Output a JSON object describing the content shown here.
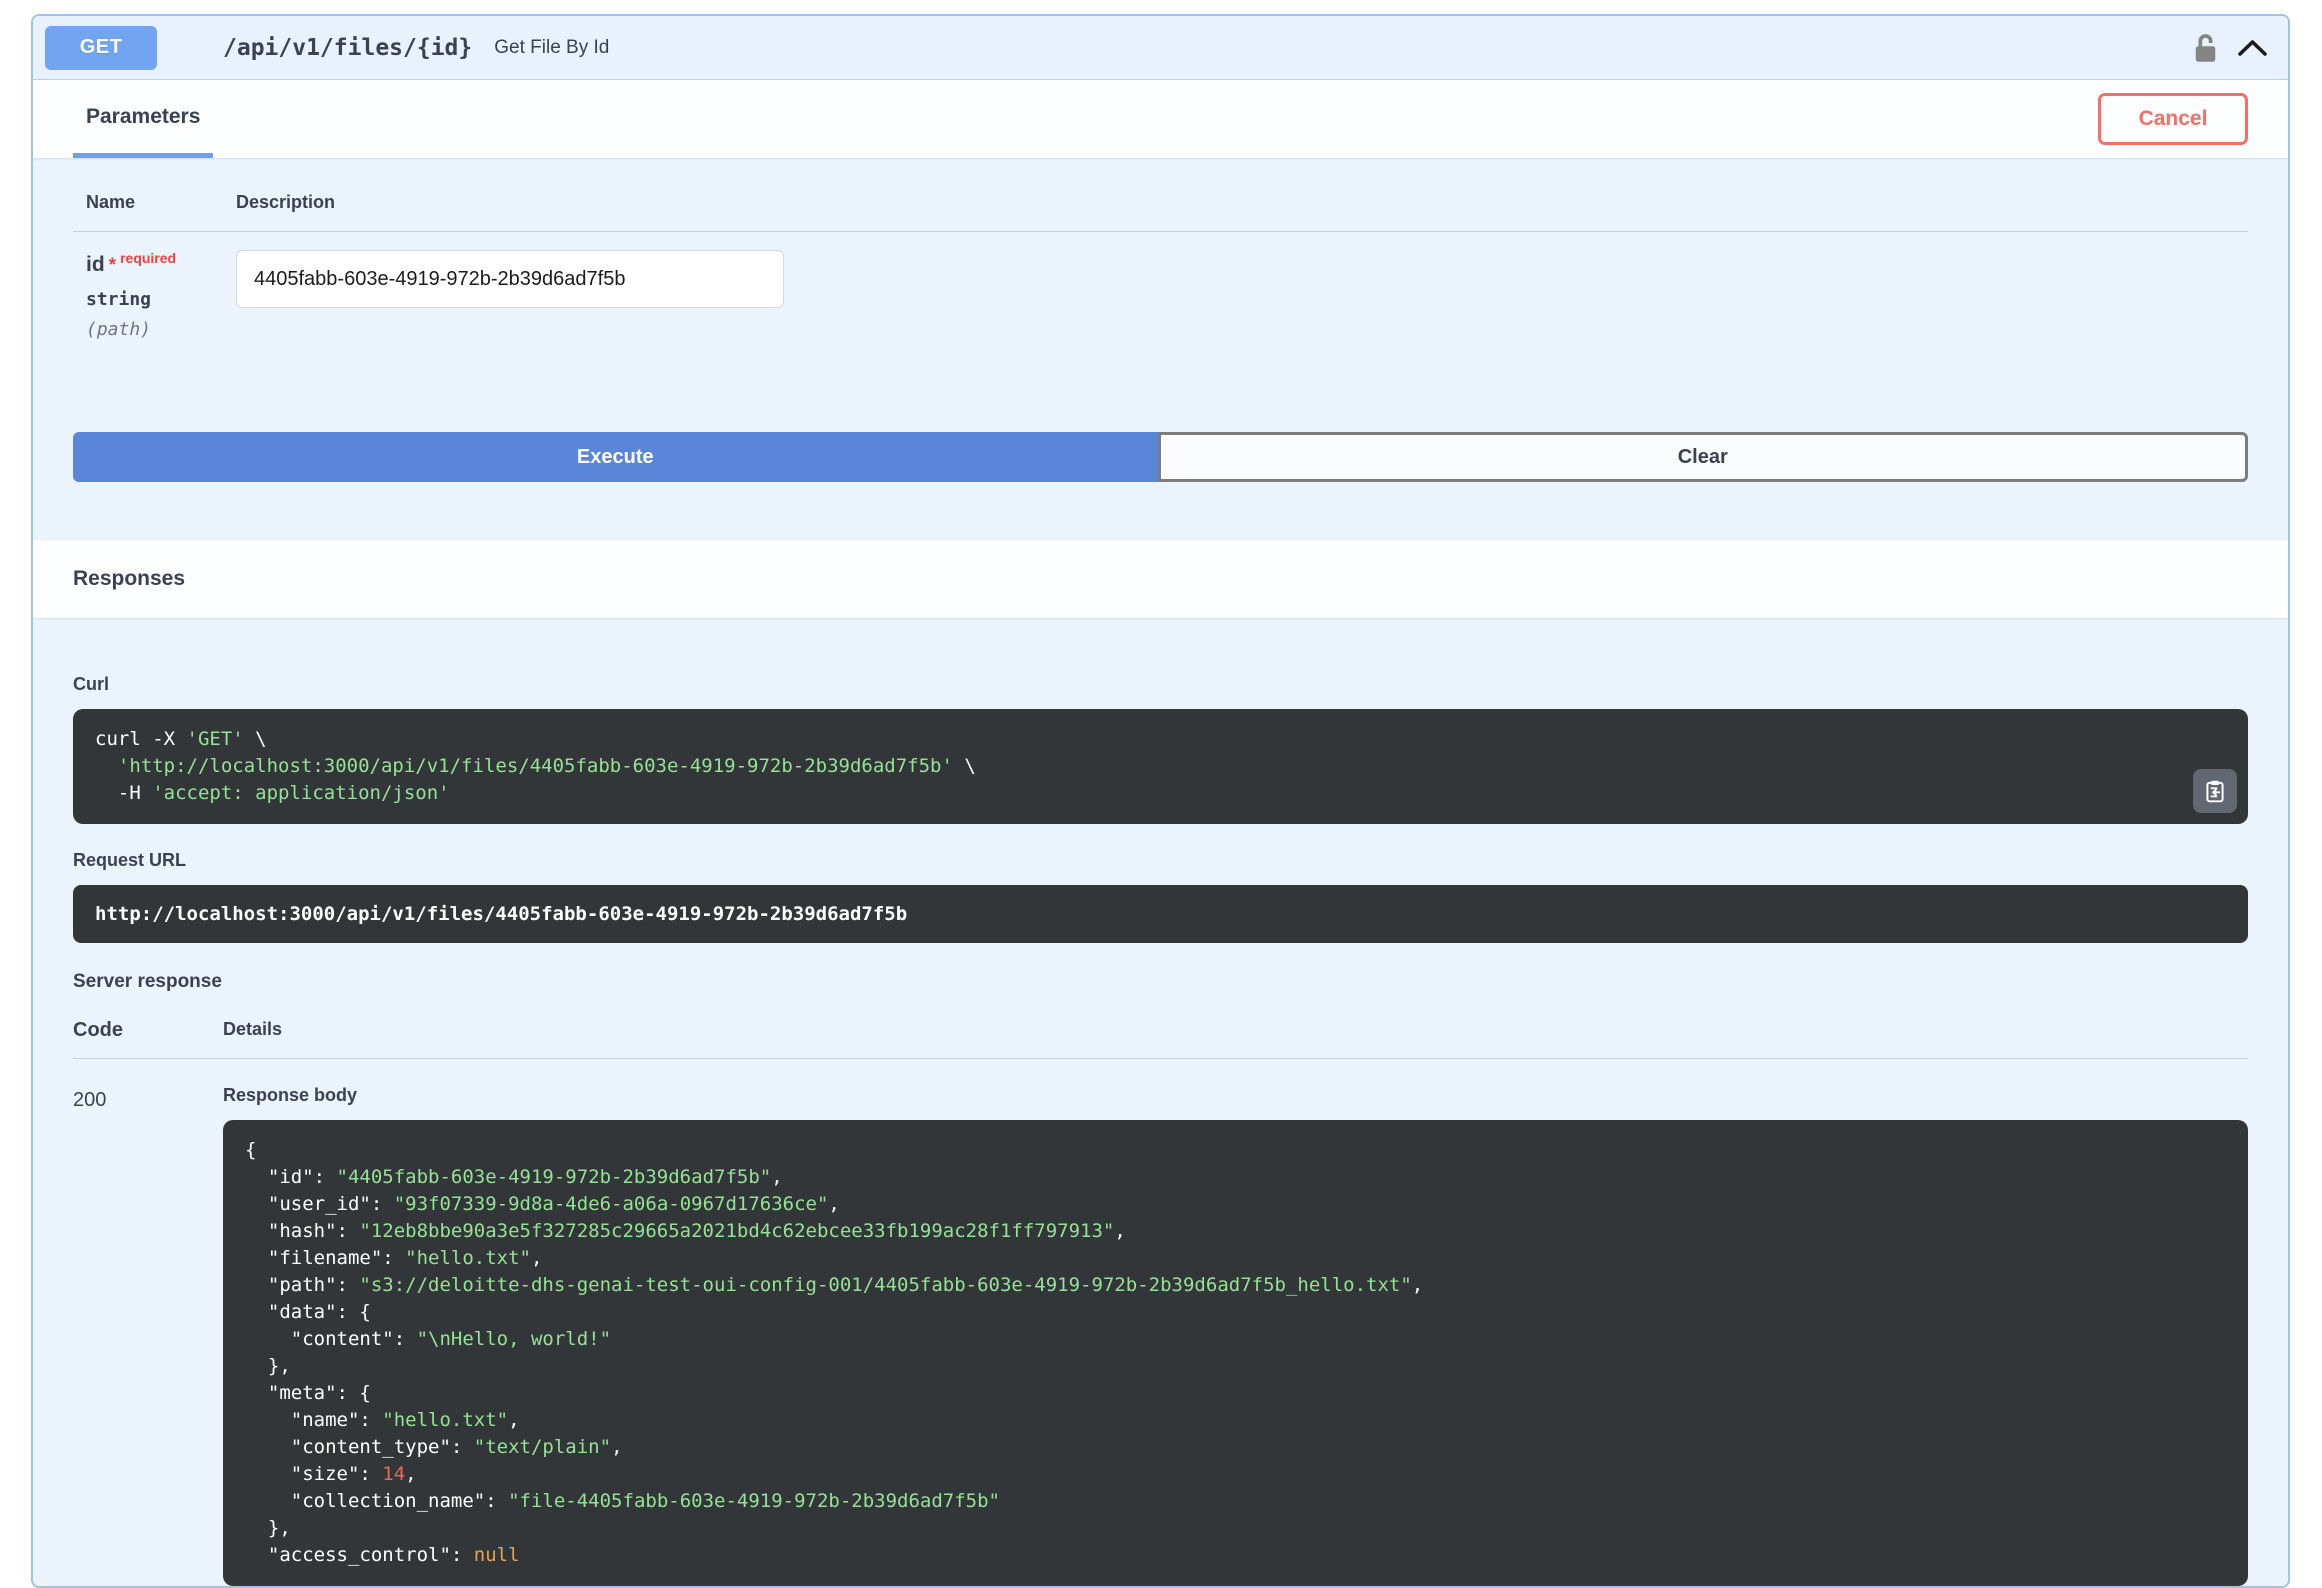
{
  "endpoint": {
    "method": "GET",
    "path": "/api/v1/files/{id}",
    "summary": "Get File By Id"
  },
  "header": {
    "parameters_tab_label": "Parameters",
    "cancel_label": "Cancel"
  },
  "parameters": {
    "col_name": "Name",
    "col_description": "Description",
    "row": {
      "name": "id",
      "required_star": "*",
      "required_label": "required",
      "type": "string",
      "location": "(path)",
      "value": "4405fabb-603e-4919-972b-2b39d6ad7f5b"
    }
  },
  "actions": {
    "execute_label": "Execute",
    "clear_label": "Clear"
  },
  "responses": {
    "title": "Responses",
    "curl_label": "Curl",
    "curl_lines": [
      [
        {
          "t": "plain",
          "v": "curl -X "
        },
        {
          "t": "str",
          "v": "'GET'"
        },
        {
          "t": "plain",
          "v": " \\"
        }
      ],
      [
        {
          "t": "plain",
          "v": "  "
        },
        {
          "t": "str",
          "v": "'http://localhost:3000/api/v1/files/4405fabb-603e-4919-972b-2b39d6ad7f5b'"
        },
        {
          "t": "plain",
          "v": " \\"
        }
      ],
      [
        {
          "t": "plain",
          "v": "  -H "
        },
        {
          "t": "str",
          "v": "'accept: application/json'"
        }
      ]
    ],
    "request_url_label": "Request URL",
    "request_url": "http://localhost:3000/api/v1/files/4405fabb-603e-4919-972b-2b39d6ad7f5b",
    "server_response_label": "Server response",
    "col_code": "Code",
    "col_details": "Details",
    "status_code": "200",
    "response_body_label": "Response body",
    "response_body_lines": [
      [
        {
          "t": "plain",
          "v": "{"
        }
      ],
      [
        {
          "t": "plain",
          "v": "  \"id\": "
        },
        {
          "t": "str",
          "v": "\"4405fabb-603e-4919-972b-2b39d6ad7f5b\""
        },
        {
          "t": "plain",
          "v": ","
        }
      ],
      [
        {
          "t": "plain",
          "v": "  \"user_id\": "
        },
        {
          "t": "str",
          "v": "\"93f07339-9d8a-4de6-a06a-0967d17636ce\""
        },
        {
          "t": "plain",
          "v": ","
        }
      ],
      [
        {
          "t": "plain",
          "v": "  \"hash\": "
        },
        {
          "t": "str",
          "v": "\"12eb8bbe90a3e5f327285c29665a2021bd4c62ebcee33fb199ac28f1ff797913\""
        },
        {
          "t": "plain",
          "v": ","
        }
      ],
      [
        {
          "t": "plain",
          "v": "  \"filename\": "
        },
        {
          "t": "str",
          "v": "\"hello.txt\""
        },
        {
          "t": "plain",
          "v": ","
        }
      ],
      [
        {
          "t": "plain",
          "v": "  \"path\": "
        },
        {
          "t": "str",
          "v": "\"s3://deloitte-dhs-genai-test-oui-config-001/4405fabb-603e-4919-972b-2b39d6ad7f5b_hello.txt\""
        },
        {
          "t": "plain",
          "v": ","
        }
      ],
      [
        {
          "t": "plain",
          "v": "  \"data\": {"
        }
      ],
      [
        {
          "t": "plain",
          "v": "    \"content\": "
        },
        {
          "t": "str",
          "v": "\"\\nHello, world!\""
        }
      ],
      [
        {
          "t": "plain",
          "v": "  },"
        }
      ],
      [
        {
          "t": "plain",
          "v": "  \"meta\": {"
        }
      ],
      [
        {
          "t": "plain",
          "v": "    \"name\": "
        },
        {
          "t": "str",
          "v": "\"hello.txt\""
        },
        {
          "t": "plain",
          "v": ","
        }
      ],
      [
        {
          "t": "plain",
          "v": "    \"content_type\": "
        },
        {
          "t": "str",
          "v": "\"text/plain\""
        },
        {
          "t": "plain",
          "v": ","
        }
      ],
      [
        {
          "t": "plain",
          "v": "    \"size\": "
        },
        {
          "t": "num",
          "v": "14"
        },
        {
          "t": "plain",
          "v": ","
        }
      ],
      [
        {
          "t": "plain",
          "v": "    \"collection_name\": "
        },
        {
          "t": "str",
          "v": "\"file-4405fabb-603e-4919-972b-2b39d6ad7f5b\""
        }
      ],
      [
        {
          "t": "plain",
          "v": "  },"
        }
      ],
      [
        {
          "t": "plain",
          "v": "  \"access_control\": "
        },
        {
          "t": "null",
          "v": "null"
        }
      ]
    ]
  },
  "colors": {
    "method_get": "#72a5f1",
    "execute_button": "#5a86d8",
    "cancel_red": "#f76e64",
    "required_red": "#f93e3e",
    "block_border": "#9cc4ed",
    "code_background": "#333639",
    "code_string": "#94e294",
    "code_number": "#e5695e",
    "code_null": "#e8a155"
  }
}
